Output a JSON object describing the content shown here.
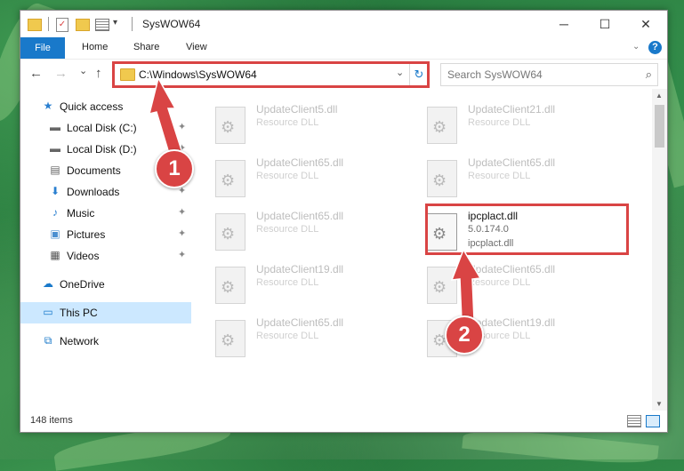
{
  "window": {
    "title": "SysWOW64"
  },
  "ribbon": {
    "tabs": [
      "File",
      "Home",
      "Share",
      "View"
    ],
    "help": "?"
  },
  "controls": {
    "minimize": "─",
    "maximize": "☐",
    "close": "✕"
  },
  "nav": {
    "back": "←",
    "forward": "→",
    "recent": "⌄",
    "up": "↑",
    "address": "C:\\Windows\\SysWOW64",
    "refresh": "↻",
    "search_placeholder": "Search SysWOW64"
  },
  "sidebar": {
    "items": [
      {
        "label": "Quick access",
        "icon": "star-icon",
        "glyph": "★"
      },
      {
        "label": "Local Disk (C:)",
        "icon": "drive-icon",
        "glyph": "▬",
        "pinned": true
      },
      {
        "label": "Local Disk (D:)",
        "icon": "drive-icon",
        "glyph": "▬",
        "pinned": true
      },
      {
        "label": "Documents",
        "icon": "documents-icon",
        "glyph": "▤",
        "pinned": true
      },
      {
        "label": "Downloads",
        "icon": "downloads-icon",
        "glyph": "⬇",
        "pinned": true
      },
      {
        "label": "Music",
        "icon": "music-icon",
        "glyph": "♪",
        "pinned": true
      },
      {
        "label": "Pictures",
        "icon": "pictures-icon",
        "glyph": "▣",
        "pinned": true
      },
      {
        "label": "Videos",
        "icon": "videos-icon",
        "glyph": "▦",
        "pinned": true
      },
      {
        "label": "OneDrive",
        "icon": "cloud-icon",
        "glyph": "☁"
      },
      {
        "label": "This PC",
        "icon": "computer-icon",
        "glyph": "▭",
        "selected": true
      },
      {
        "label": "Network",
        "icon": "network-icon",
        "glyph": "⧉"
      }
    ],
    "pin_glyph": "📌"
  },
  "files": [
    {
      "name": "UpdateClient5.dll",
      "type": "Resource DLL"
    },
    {
      "name": "UpdateClient21.dll",
      "type": "Resource DLL"
    },
    {
      "name": "UpdateClient65.dll",
      "type": "Resource DLL"
    },
    {
      "name": "UpdateClient65.dll",
      "type": "Resource DLL"
    },
    {
      "name": "UpdateClient65.dll",
      "type": "Resource DLL"
    },
    {
      "name": "ipcplact.dll",
      "type": "5.0.174.0",
      "desc": "ipcplact.dll",
      "highlight": true
    },
    {
      "name": "UpdateClient19.dll",
      "type": "Resource DLL"
    },
    {
      "name": "UpdateClient65.dll",
      "type": "Resource DLL"
    },
    {
      "name": "UpdateClient65.dll",
      "type": "Resource DLL"
    },
    {
      "name": "UpdateClient19.dll",
      "type": "Resource DLL"
    }
  ],
  "status": {
    "count": "148 items"
  },
  "annotations": {
    "badge1": "1",
    "badge2": "2",
    "color": "#d94444"
  }
}
